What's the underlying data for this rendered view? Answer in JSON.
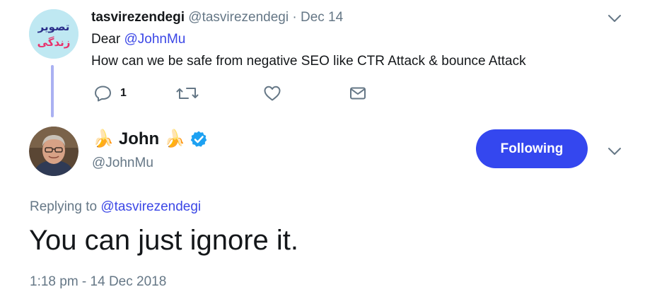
{
  "tweet1": {
    "display_name": "tasvirezendegi",
    "handle": "@tasvirezendegi",
    "separator": "·",
    "date": "Dec 14",
    "line1_prefix": "Dear ",
    "line1_mention": "@JohnMu",
    "line2": "How can we be safe from negative SEO like CTR Attack & bounce Attack",
    "reply_count": "1",
    "avatar_logo_text": [
      "تصویر",
      "زندگی"
    ],
    "icons": [
      "reply-icon",
      "retweet-icon",
      "like-icon",
      "dm-icon",
      "chevron-down-icon"
    ]
  },
  "tweet2": {
    "display_name": "John",
    "emoji_left": "🍌",
    "emoji_right": "🍌",
    "handle": "@JohnMu",
    "follow_label": "Following",
    "replying_prefix": "Replying to ",
    "replying_mention": "@tasvirezendegi",
    "text": "You can just ignore it.",
    "timestamp": "1:18 pm - 14 Dec 2018",
    "icons": [
      "verified-icon",
      "chevron-down-icon"
    ]
  },
  "colors": {
    "accent": "#3447ef",
    "mention": "#3b47e6",
    "muted": "#657786",
    "thread_line": "#aab1f2",
    "verified": "#1da1f2"
  }
}
